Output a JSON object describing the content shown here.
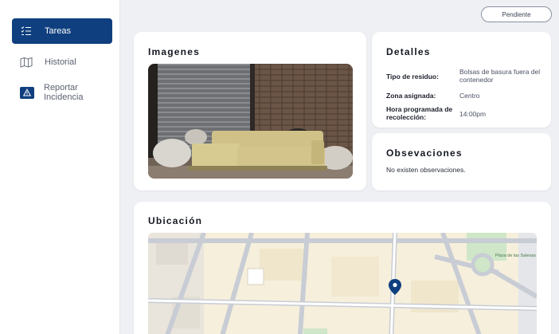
{
  "sidebar": {
    "items": [
      {
        "label": "Tareas",
        "icon": "task-list-icon",
        "active": true
      },
      {
        "label": "Historial",
        "icon": "map-book-icon",
        "active": false
      },
      {
        "label": "Reportar Incidencia",
        "icon": "warning-icon",
        "active": false
      }
    ]
  },
  "header": {
    "status": "Pendiente"
  },
  "images": {
    "title": "Imagenes"
  },
  "details": {
    "title": "Detalles",
    "rows": [
      {
        "label": "Tipo de residuo:",
        "value": "Bolsas de basura fuera del contenedor"
      },
      {
        "label": "Zona asignada:",
        "value": "Centro"
      },
      {
        "label": "Hora programada de recolección:",
        "value": "14:00pm"
      }
    ]
  },
  "observations": {
    "title": "Obsevaciones",
    "text": "No existen observaciones."
  },
  "location": {
    "title": "Ubicación",
    "poi_label": "Plaza de las Salesas"
  },
  "colors": {
    "primary": "#0f3f7f",
    "background": "#eef0f4",
    "map_marker": "#0f3f7f"
  }
}
